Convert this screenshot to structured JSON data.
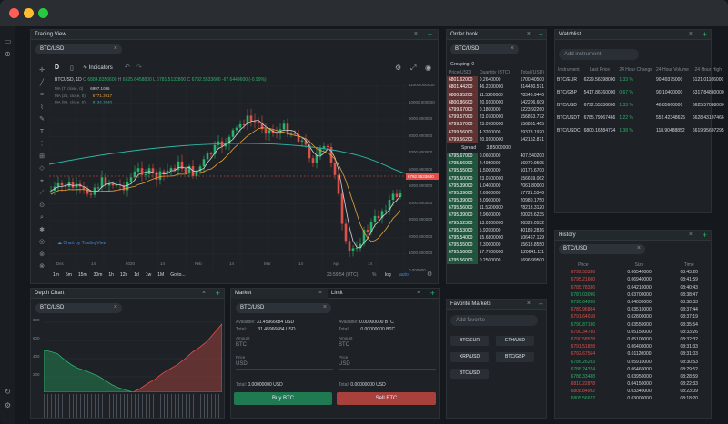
{
  "colors": {
    "green": "#28b26a",
    "red": "#e0504a",
    "bg": "#1e2226"
  },
  "traffic": [
    "#ff5f57",
    "#ffbd2e",
    "#28c940"
  ],
  "left_icons": [
    "layout-icon",
    "add-circle-icon",
    "refresh-icon",
    "settings-icon"
  ],
  "trading": {
    "title": "Trading View",
    "symbol": "BTC/USD",
    "interval": "D",
    "indicators": "Indicators",
    "ohlc": {
      "name": "BTCUSD, 1D",
      "o": "6884.8356600",
      "h": "6925.6458800",
      "l": "6781.5132800",
      "c": "6792.5533600",
      "chg": "-67.6449600 (-0.99%)"
    },
    "ma": [
      {
        "label": "MA (7, close, 0)",
        "value": "6997.1086"
      },
      {
        "label": "MA (25, close, 0)",
        "value": "6771.3917"
      },
      {
        "label": "MA (99, close, 0)",
        "value": "8134.3840"
      }
    ],
    "price_ticks": [
      "11000.000000",
      "10000.000000",
      "9000.000000",
      "8000.000000",
      "7000.000000",
      "6000.000000",
      "5000.000000",
      "4000.000000",
      "3000.000000",
      "2000.000000",
      "1000.000000",
      "0.000000"
    ],
    "current_price": "6792.5533600",
    "dates": [
      "Dec",
      "14",
      "2020",
      "14",
      "Feb",
      "14",
      "Mar",
      "14",
      "Apr",
      "14"
    ],
    "ranges": [
      "1m",
      "5m",
      "15m",
      "30m",
      "1h",
      "12h",
      "1d",
      "1w",
      "1M",
      "Go to..."
    ],
    "time": "23:59:54 (UTC)",
    "pct": "%",
    "log": "log",
    "auto": "auto",
    "brand": "Chart by TradingView"
  },
  "orderbook": {
    "title": "Order book",
    "symbol": "BTC/USD",
    "grouping": "Grouping: 0",
    "headers": [
      "Price(USD)",
      "Quantity (BTC)",
      "Total (USD)"
    ],
    "asks": [
      [
        "6801.62000",
        "0.2640000",
        "1700.40500"
      ],
      [
        "6801.44200",
        "46.2300000",
        "314430.571"
      ],
      [
        "6800.95200",
        "11.5200000",
        "78346.9440"
      ],
      [
        "6800.86600",
        "20.9100000",
        "142206.609"
      ],
      [
        "6799.67000",
        "0.1800000",
        "1223.92260"
      ],
      [
        "6799.57000",
        "23.0700000",
        "156863.772"
      ],
      [
        "6799.57000",
        "23.0700000",
        "156861.465"
      ],
      [
        "6799.56000",
        "4.3200000",
        "29373.1920"
      ],
      [
        "6799.56200",
        "20.9100000",
        "142152.871"
      ]
    ],
    "spread_label": "Spread",
    "spread": "3.85000000",
    "bids": [
      [
        "6795.67000",
        "0.0600000",
        "407.540200"
      ],
      [
        "6795.56000",
        "2.4950000",
        "16970.9595"
      ],
      [
        "6795.55000",
        "1.5000000",
        "10176.6700"
      ],
      [
        "6795.50000",
        "23.0700000",
        "156669.062"
      ],
      [
        "6795.39000",
        "1.0400000",
        "7061.80000"
      ],
      [
        "6795.39000",
        "2.6900000",
        "17721.5346"
      ],
      [
        "6795.39000",
        "3.0900000",
        "20980.1750"
      ],
      [
        "6795.56000",
        "11.5200000",
        "78213.3120"
      ],
      [
        "6795.39000",
        "2.9600000",
        "20028.6235"
      ],
      [
        "6795.52300",
        "13.0100000",
        "86329.0532"
      ],
      [
        "6795.53000",
        "5.9200000",
        "40189.2816"
      ],
      [
        "6795.54000",
        "15.6800000",
        "106467.129"
      ],
      [
        "6795.55000",
        "2.3000000",
        "15613.8550"
      ],
      [
        "6795.56000",
        "17.7700000",
        "120641.111"
      ],
      [
        "6795.56000",
        "0.2500000",
        "1696.99500"
      ]
    ]
  },
  "watchlist": {
    "title": "Watchlist",
    "placeholder": "Add instrument",
    "headers": [
      "Instrument",
      "Last Price",
      "24 Hour Change",
      "24 Hour Volume",
      "24 Hour High"
    ],
    "rows": [
      [
        "BTC/EUR",
        "6229.56398000",
        "1.33 %",
        "90.49375000",
        "6121.01166000"
      ],
      [
        "BTC/GBP",
        "5417.86760000",
        "0.67 %",
        "90.10400000",
        "5317.84880000"
      ],
      [
        "BTC/USD",
        "6792.55336000",
        "1.33 %",
        "46.85660000",
        "6625.57088000"
      ],
      [
        "BTC/USDT",
        "6785.79967466",
        "1.22 %",
        "552.42348625",
        "6628.43107466"
      ],
      [
        "BTC/USDC",
        "6800.16584734",
        "1.38 %",
        "118.90488852",
        "6619.95607295"
      ]
    ]
  },
  "history": {
    "title": "History",
    "symbol": "BTC/USD",
    "headers": [
      "Price",
      "Size",
      "Time"
    ],
    "rows": [
      [
        "6792.55336",
        "0.06540000",
        "08:43:20",
        "r"
      ],
      [
        "6795.21600",
        "0.06940000",
        "08:41:59",
        "r"
      ],
      [
        "6785.78336",
        "0.04210000",
        "08:40:43",
        "r"
      ],
      [
        "6787.03096",
        "0.03700000",
        "08:38:47",
        "g"
      ],
      [
        "6790.64200",
        "0.04030000",
        "08:38:33",
        "g"
      ],
      [
        "6789.96884",
        "0.03510000",
        "08:37:44",
        "r"
      ],
      [
        "6791.64018",
        "0.02800000",
        "08:37:19",
        "r"
      ],
      [
        "6790.87196",
        "0.03550000",
        "08:35:54",
        "g"
      ],
      [
        "6790.34780",
        "0.05150000",
        "08:33:26",
        "r"
      ],
      [
        "6790.58578",
        "0.05100000",
        "08:32:32",
        "r"
      ],
      [
        "6791.51828",
        "0.06400000",
        "08:31:33",
        "r"
      ],
      [
        "6792.67564",
        "0.01120000",
        "08:31:03",
        "r"
      ],
      [
        "6786.26293",
        "0.05910000",
        "08:30:53",
        "g"
      ],
      [
        "6788.24324",
        "0.06460000",
        "08:29:52",
        "g"
      ],
      [
        "6788.33488",
        "0.03950000",
        "08:28:59",
        "g"
      ],
      [
        "6810.22878",
        "0.04150000",
        "08:22:33",
        "r"
      ],
      [
        "6808.84992",
        "0.03340000",
        "08:23:09",
        "r"
      ],
      [
        "6805.56622",
        "0.03000000",
        "08:18:20",
        "g"
      ]
    ]
  },
  "depth": {
    "title": "Depth Chart",
    "symbol": "BTC/USD",
    "ticks": [
      "800",
      "600",
      "400",
      "200"
    ],
    "bids": [
      0.58,
      0.56,
      0.53,
      0.45,
      0.38,
      0.33,
      0.3,
      0.26,
      0.22,
      0.16,
      0.1,
      0.06,
      0.03,
      0.0
    ],
    "asks": [
      0.0,
      0.05,
      0.12,
      0.18,
      0.26,
      0.32,
      0.38,
      0.46,
      0.55,
      0.62,
      0.7,
      0.82,
      0.94
    ]
  },
  "market": {
    "tab_market": "Market",
    "tab_limit": "Limit",
    "symbol": "BTC/USD",
    "available": "Available:",
    "total": "Total:",
    "buy_avail": "31.45966684 USD",
    "buy_total": "31.45966684 USD",
    "sell_avail": "0.00000000 BTC",
    "sell_total": "0.00000000 BTC",
    "amount": "Amount",
    "price": "Price",
    "unit_btc": "BTC",
    "unit_usd": "USD",
    "buy_total_line": "0.00000000 USD",
    "sell_total_line": "0.00000000 USD",
    "buy": "Buy BTC",
    "sell": "Sell BTC"
  },
  "favorites": {
    "title": "Favorite Markets",
    "placeholder": "Add favorite",
    "items": [
      "BTC/EUR",
      "ETH/USD",
      "XRP/USD",
      "BTC/GBP",
      "BTC/USD"
    ]
  }
}
